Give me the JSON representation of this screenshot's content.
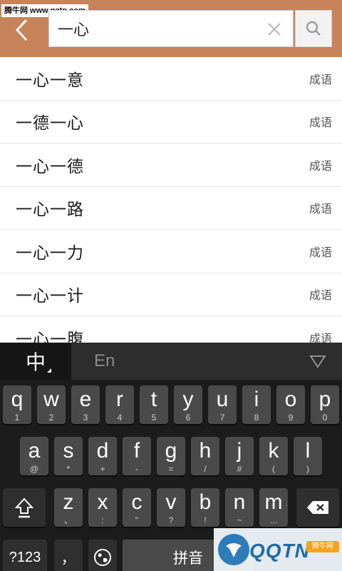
{
  "watermark": {
    "top_text": "腾牛网 www.qqtn.com",
    "bottom_text": "QQTN",
    "bottom_badge": "腾牛网"
  },
  "header": {
    "search_value": "一心",
    "back_icon": "chevron-left-icon",
    "clear_icon": "close-icon",
    "search_icon": "search-icon"
  },
  "results": [
    {
      "word": "一心一意",
      "tag": "成语"
    },
    {
      "word": "一德一心",
      "tag": "成语"
    },
    {
      "word": "一心一德",
      "tag": "成语"
    },
    {
      "word": "一心一路",
      "tag": "成语"
    },
    {
      "word": "一心一力",
      "tag": "成语"
    },
    {
      "word": "一心一计",
      "tag": "成语"
    },
    {
      "word": "一心一腹",
      "tag": "成语"
    }
  ],
  "keyboard": {
    "lang_zh": "中",
    "lang_en": "En",
    "row1": [
      {
        "main": "q",
        "sub": "1"
      },
      {
        "main": "w",
        "sub": "2"
      },
      {
        "main": "e",
        "sub": "3"
      },
      {
        "main": "r",
        "sub": "4"
      },
      {
        "main": "t",
        "sub": "5"
      },
      {
        "main": "y",
        "sub": "6"
      },
      {
        "main": "u",
        "sub": "7"
      },
      {
        "main": "i",
        "sub": "8"
      },
      {
        "main": "o",
        "sub": "9"
      },
      {
        "main": "p",
        "sub": "0"
      }
    ],
    "row2": [
      {
        "main": "a",
        "sub": "@"
      },
      {
        "main": "s",
        "sub": "*"
      },
      {
        "main": "d",
        "sub": "+"
      },
      {
        "main": "f",
        "sub": "-"
      },
      {
        "main": "g",
        "sub": "="
      },
      {
        "main": "h",
        "sub": "/"
      },
      {
        "main": "j",
        "sub": "#"
      },
      {
        "main": "k",
        "sub": "("
      },
      {
        "main": "l",
        "sub": ")"
      }
    ],
    "row3": [
      {
        "main": "z",
        "sub": "、"
      },
      {
        "main": "x",
        "sub": ":"
      },
      {
        "main": "c",
        "sub": "\""
      },
      {
        "main": "v",
        "sub": "?"
      },
      {
        "main": "b",
        "sub": "!"
      },
      {
        "main": "n",
        "sub": "~"
      },
      {
        "main": "m",
        "sub": "…"
      }
    ],
    "sym_label": "?123",
    "comma_label": "，",
    "space_label": "拼音"
  },
  "colors": {
    "header_bg": "#c9835a",
    "keyboard_bg": "#1c1c1c",
    "key_bg": "#4a4a4a"
  }
}
